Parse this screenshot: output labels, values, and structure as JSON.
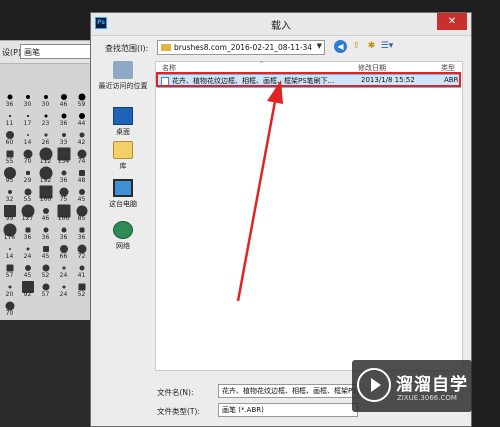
{
  "background_panel": {
    "preset_label": "设(P):",
    "preset_value": "画笔",
    "brush_sizes": [
      "36",
      "30",
      "30",
      "46",
      "59",
      "11",
      "17",
      "23",
      "36",
      "44",
      "60",
      "14",
      "26",
      "33",
      "42",
      "55",
      "70",
      "112",
      "134",
      "74",
      "95",
      "29",
      "192",
      "36",
      "48",
      "32",
      "55",
      "100",
      "75",
      "45",
      "99",
      "127",
      "46",
      "106",
      "85",
      "176",
      "36",
      "36",
      "36",
      "36",
      "14",
      "24",
      "45",
      "66",
      "72",
      "57",
      "45",
      "52",
      "24",
      "41",
      "20",
      "92",
      "57",
      "24",
      "52",
      "70"
    ]
  },
  "dialog": {
    "title": "载入",
    "app_icon_text": "Ps",
    "close_glyph": "✕",
    "look_in_label": "查找范围(I):",
    "look_in_value": "brushes8.com_2016-02-21_08-11-34",
    "places": [
      {
        "label": "最近访问的位置",
        "icon": "recent-places-icon"
      },
      {
        "label": "桌面",
        "icon": "desktop-icon"
      },
      {
        "label": "库",
        "icon": "library-icon"
      },
      {
        "label": "这台电脑",
        "icon": "this-pc-icon"
      },
      {
        "label": "网络",
        "icon": "network-icon"
      }
    ],
    "columns": {
      "name": "名称",
      "date": "修改日期",
      "type": "类型"
    },
    "files": [
      {
        "name": "花卉、植物花纹边框、相框、画框、框架PS笔刷下...",
        "date": "2013/1/8 15:52",
        "type": "ABR"
      }
    ],
    "file_name_label": "文件名(N):",
    "file_name_value": "花卉、植物花纹边框、相框、画框、框架PS笔刷下载",
    "file_type_label": "文件类型(T):",
    "file_type_value": "画笔 (*.ABR)"
  },
  "annotation": {
    "color": "#e02424"
  },
  "watermark": {
    "name": "溜溜自学",
    "url": "ZIXUE.3066.COM"
  }
}
